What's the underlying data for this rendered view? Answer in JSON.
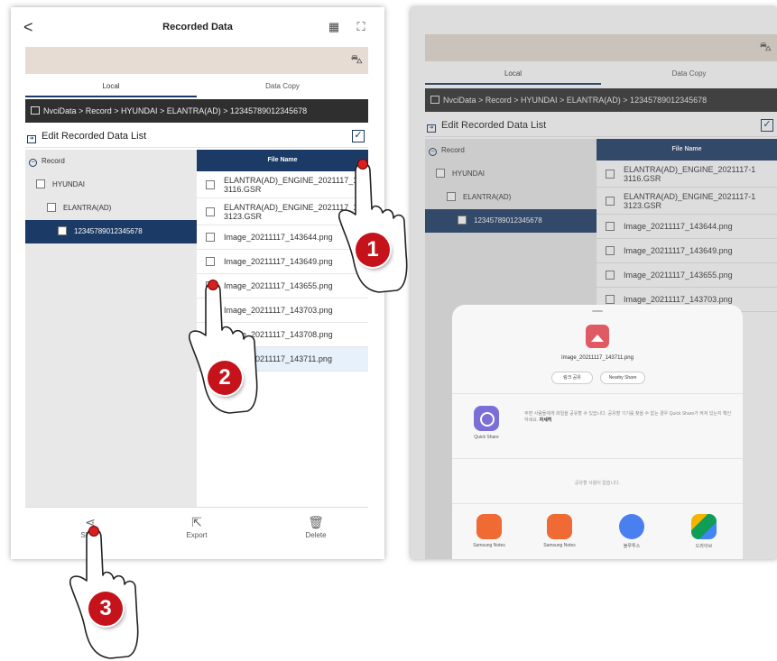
{
  "left": {
    "header": {
      "back_glyph": "<",
      "title": "Recorded Data"
    },
    "tabs": [
      "Local",
      "Data Copy"
    ],
    "breadcrumb": "NvciData > Record > HYUNDAI > ELANTRA(AD) > 12345789012345678",
    "edit_label": "Edit Recorded Data List",
    "tree": {
      "root": "Record",
      "items": [
        "HYUNDAI",
        "ELANTRA(AD)",
        "12345789012345678"
      ]
    },
    "files_header": "File Name",
    "files": [
      {
        "line1": "ELANTRA(AD)_ENGINE_2021117_14",
        "line2": "3116.GSR"
      },
      {
        "line1": "ELANTRA(AD)_ENGINE_2021117_14",
        "line2": "3123.GSR"
      },
      {
        "line1": "Image_20211117_143644.png"
      },
      {
        "line1": "Image_20211117_143649.png"
      },
      {
        "line1": "Image_20211117_143655.png"
      },
      {
        "line1": "Image_20211117_143703.png"
      },
      {
        "line1": "Image_20211117_143708.png"
      },
      {
        "line1": "Image_20211117_143711.png"
      }
    ],
    "bottom": {
      "share": "Share",
      "export": "Export",
      "delete": "Delete"
    }
  },
  "markers": [
    "1",
    "2",
    "3"
  ],
  "right": {
    "tabs": [
      "Local",
      "Data Copy"
    ],
    "breadcrumb": "NvciData > Record > HYUNDAI > ELANTRA(AD) > 12345789012345678",
    "edit_label": "Edit Recorded Data List",
    "tree": {
      "root": "Record",
      "items": [
        "HYUNDAI",
        "ELANTRA(AD)",
        "12345789012345678"
      ]
    },
    "files_header": "File Name",
    "files": [
      {
        "line1": "ELANTRA(AD)_ENGINE_2021117-1",
        "line2": "3116.GSR"
      },
      {
        "line1": "ELANTRA(AD)_ENGINE_2021117-1",
        "line2": "3123.GSR"
      },
      {
        "line1": "Image_20211117_143644.png"
      },
      {
        "line1": "Image_20211117_143649.png"
      },
      {
        "line1": "Image_20211117_143655.png"
      },
      {
        "line1": "Image_20211117_143703.png"
      }
    ],
    "share_sheet": {
      "file_name": "Image_20211117_143711.png",
      "pill_left": "링크 공유",
      "pill_right": "Nearby Share",
      "quick_share_label": "Quick Share",
      "quick_share_desc": "주변 사람들에게 파일을 공유할 수 있습니다. 공유할 기기를 찾을 수 없는 경우 Quick Share가 켜져 있는지 확인하세요.",
      "quick_share_link": "자세히",
      "nobody_text": "공유할 사람이 없습니다.",
      "apps": [
        "Samsung Notes",
        "Samsung Notes",
        "블루투스",
        "드라이브"
      ]
    }
  }
}
